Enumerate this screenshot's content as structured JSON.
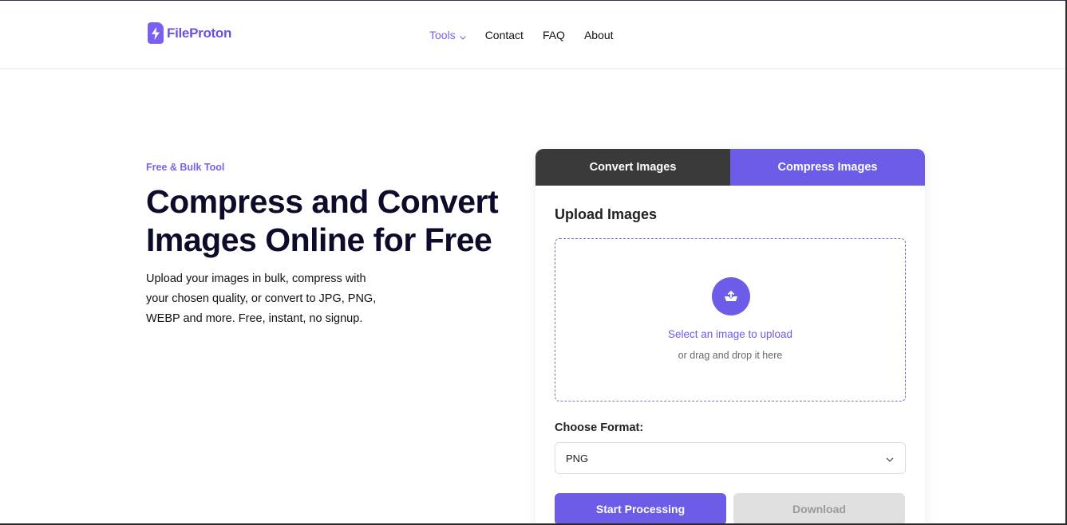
{
  "colors": {
    "accent": "#6c5ce7",
    "brand": "#7b5ff0",
    "dark_tab": "#3a3a3a",
    "disabled": "#e0e0e0"
  },
  "header": {
    "logo_text": "FileProton",
    "logo_icon": "bolt-icon",
    "nav": [
      {
        "label": "Tools",
        "active": true,
        "has_dropdown": true
      },
      {
        "label": "Contact"
      },
      {
        "label": "FAQ"
      },
      {
        "label": "About"
      }
    ]
  },
  "hero": {
    "eyebrow": "Free & Bulk Tool",
    "title_line1": "Compress and Convert",
    "title_line2": "Images Online for Free",
    "desc_line1": "Upload your images in bulk, compress with",
    "desc_line2": "your chosen quality, or convert to JPG, PNG,",
    "desc_line3": "WEBP and more. Free, instant, no signup."
  },
  "tool": {
    "tabs": [
      {
        "label": "Convert Images",
        "active": true
      },
      {
        "label": "Compress Images",
        "active": false
      }
    ],
    "upload_title": "Upload Images",
    "upload_icon": "upload-icon",
    "select_link": "Select an image to upload",
    "drag_hint": "or drag and drop it here",
    "format_label": "Choose Format:",
    "format_value": "PNG",
    "start_label": "Start Processing",
    "download_label": "Download"
  }
}
